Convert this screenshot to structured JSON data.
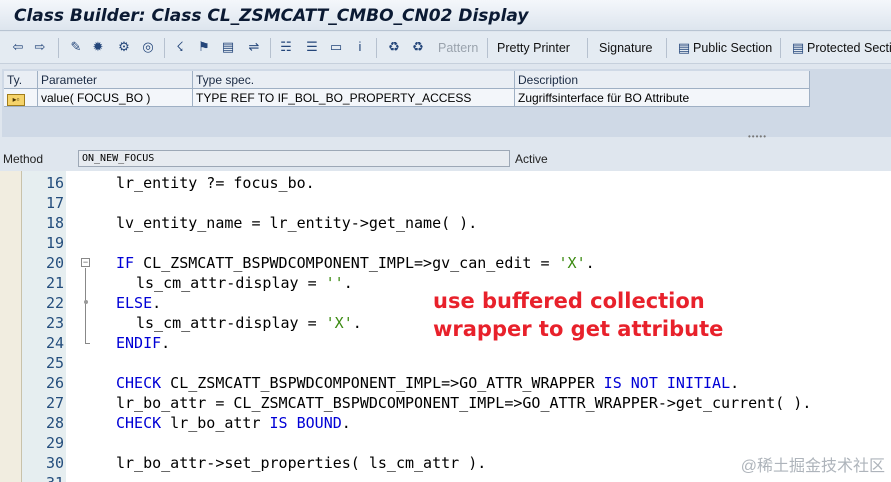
{
  "window": {
    "title": "Class Builder: Class CL_ZSMCATT_CMBO_CN02 Display"
  },
  "toolbar": {
    "icons": [
      "back-arrow-icon",
      "forward-arrow-icon",
      "edit-pencil-icon",
      "toggle-display-change-icon",
      "activate-icon",
      "check-icon",
      "where-used-icon",
      "navigate-icon",
      "other-object-icon",
      "display-object-list-icon",
      "hierarchy-icon",
      "insert-statement-icon",
      "window-icon",
      "info-icon",
      "breakpoint-icon",
      "session-breakpoint-icon"
    ],
    "pattern_label": "Pattern",
    "pretty_printer_label": "Pretty Printer",
    "signature_label": "Signature",
    "public_section_label": "Public Section",
    "protected_section_label": "Protected Section"
  },
  "parameters": {
    "headers": {
      "type": "Ty.",
      "parameter": "Parameter",
      "type_spec": "Type spec.",
      "description": "Description"
    },
    "rows": [
      {
        "type_icon": "▸▫",
        "parameter": "value( FOCUS_BO )",
        "type_spec": "TYPE REF TO IF_BOL_BO_PROPERTY_ACCESS",
        "description": "Zugriffsinterface für BO Attribute"
      }
    ]
  },
  "method": {
    "label": "Method",
    "name": "ON_NEW_FOCUS",
    "status": "Active"
  },
  "code": {
    "lines": [
      {
        "no": "16",
        "segments": [
          {
            "t": "lr_entity ?= focus_bo.",
            "c": "plain"
          }
        ],
        "indent": 1
      },
      {
        "no": "17",
        "segments": [],
        "indent": 1
      },
      {
        "no": "18",
        "segments": [
          {
            "t": "lv_entity_name = lr_entity->get_name( ).",
            "c": "plain"
          }
        ],
        "indent": 1
      },
      {
        "no": "19",
        "segments": [],
        "indent": 1
      },
      {
        "no": "20",
        "segments": [
          {
            "t": "IF",
            "c": "kw"
          },
          {
            "t": " CL_ZSMCATT_BSPWDCOMPONENT_IMPL=>gv_can_edit = ",
            "c": "plain"
          },
          {
            "t": "'X'",
            "c": "str"
          },
          {
            "t": ".",
            "c": "plain"
          }
        ],
        "indent": 1
      },
      {
        "no": "21",
        "segments": [
          {
            "t": "ls_cm_attr-display = ",
            "c": "plain"
          },
          {
            "t": "''",
            "c": "str"
          },
          {
            "t": ".",
            "c": "plain"
          }
        ],
        "indent": 2
      },
      {
        "no": "22",
        "segments": [
          {
            "t": "ELSE",
            "c": "kw"
          },
          {
            "t": ".",
            "c": "plain"
          }
        ],
        "indent": 1
      },
      {
        "no": "23",
        "segments": [
          {
            "t": "ls_cm_attr-display = ",
            "c": "plain"
          },
          {
            "t": "'X'",
            "c": "str"
          },
          {
            "t": ".",
            "c": "plain"
          }
        ],
        "indent": 2
      },
      {
        "no": "24",
        "segments": [
          {
            "t": "ENDIF",
            "c": "kw"
          },
          {
            "t": ".",
            "c": "plain"
          }
        ],
        "indent": 1
      },
      {
        "no": "25",
        "segments": [],
        "indent": 1
      },
      {
        "no": "26",
        "segments": [
          {
            "t": "CHECK",
            "c": "kw"
          },
          {
            "t": " CL_ZSMCATT_BSPWDCOMPONENT_IMPL=>GO_ATTR_WRAPPER ",
            "c": "plain"
          },
          {
            "t": "IS NOT INITIAL",
            "c": "kw"
          },
          {
            "t": ".",
            "c": "plain"
          }
        ],
        "indent": 1
      },
      {
        "no": "27",
        "segments": [
          {
            "t": "lr_bo_attr = CL_ZSMCATT_BSPWDCOMPONENT_IMPL=>GO_ATTR_WRAPPER->get_current( ).",
            "c": "plain"
          }
        ],
        "indent": 1
      },
      {
        "no": "28",
        "segments": [
          {
            "t": "CHECK",
            "c": "kw"
          },
          {
            "t": " lr_bo_attr ",
            "c": "plain"
          },
          {
            "t": "IS BOUND",
            "c": "kw"
          },
          {
            "t": ".",
            "c": "plain"
          }
        ],
        "indent": 1
      },
      {
        "no": "29",
        "segments": [],
        "indent": 1
      },
      {
        "no": "30",
        "segments": [
          {
            "t": "lr_bo_attr->set_properties( ls_cm_attr ).",
            "c": "plain"
          }
        ],
        "indent": 1
      },
      {
        "no": "31",
        "segments": [],
        "indent": 1
      }
    ]
  },
  "annotation": {
    "text": "use buffered collection\nwrapper to get attribute",
    "color": "#e8212b"
  },
  "watermark": {
    "text": "@稀土掘金技术社区"
  }
}
